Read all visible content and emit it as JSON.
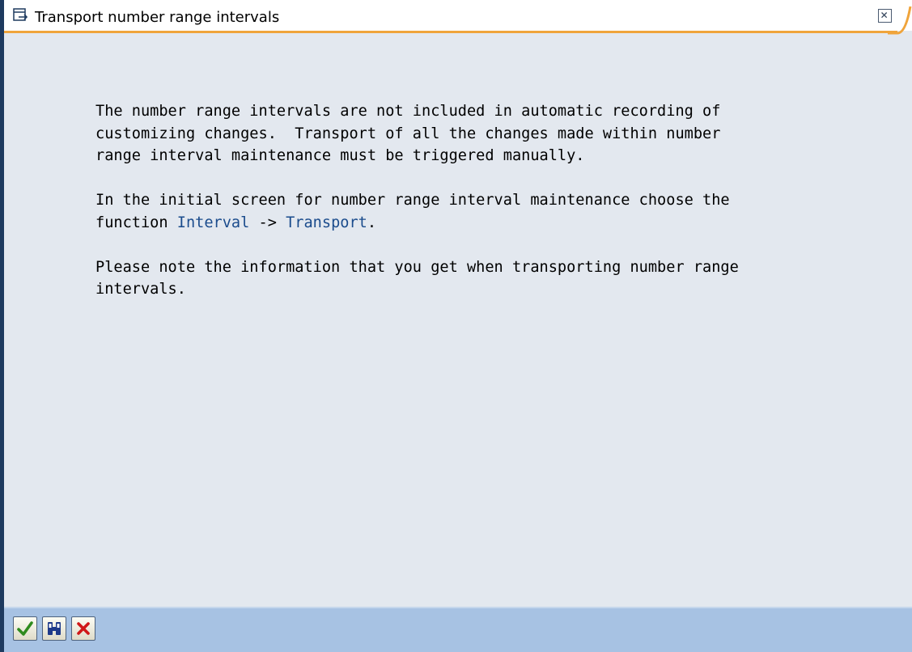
{
  "window": {
    "title": "Transport number range intervals",
    "title_icon": "window-popup-icon",
    "close_icon": "close-icon"
  },
  "message": {
    "p1": "The number range intervals are not included in automatic recording of\ncustomizing changes.  Transport of all the changes made within number\nrange interval maintenance must be triggered manually.",
    "p2_prefix": "In the initial screen for number range interval maintenance choose the\nfunction ",
    "p2_link1": "Interval",
    "p2_arrow": " -> ",
    "p2_link2": "Transport",
    "p2_suffix": ".",
    "p3": "Please note the information that you get when transporting number range\nintervals."
  },
  "footer": {
    "buttons": [
      {
        "icon": "checkmark-icon",
        "color": "#2e8b1e"
      },
      {
        "icon": "binoculars-icon",
        "color": "#1e3a8a"
      },
      {
        "icon": "cancel-x-icon",
        "color": "#d01818"
      }
    ]
  },
  "colors": {
    "background": "#e3e8ef",
    "titlebar_accent": "#f0a43b",
    "footer": "#a7c2e3",
    "link": "#1a4b8c"
  }
}
